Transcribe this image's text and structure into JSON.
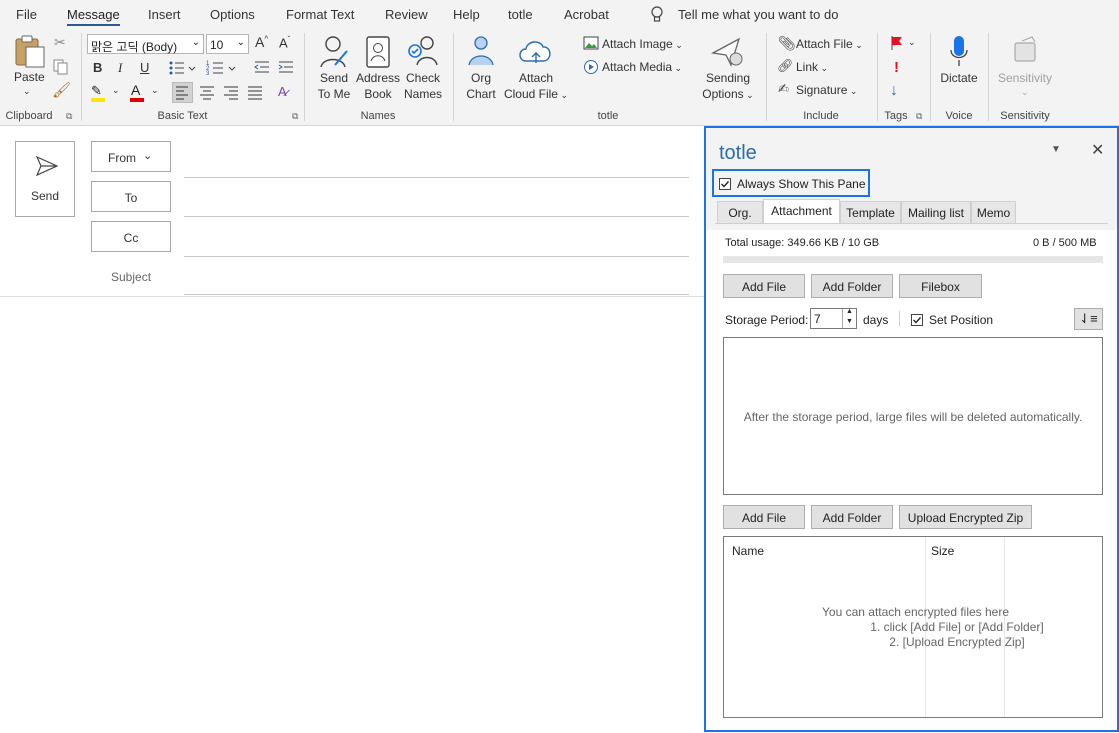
{
  "menu": {
    "file": "File",
    "message": "Message",
    "insert": "Insert",
    "options": "Options",
    "format_text": "Format Text",
    "review": "Review",
    "help": "Help",
    "totle": "totle",
    "acrobat": "Acrobat",
    "tell_me": "Tell me what you want to do"
  },
  "ribbon": {
    "paste": "Paste",
    "clipboard": "Clipboard",
    "font_name": "맑은 고딕 (Body)",
    "font_size": "10",
    "bold": "B",
    "italic": "I",
    "underline": "U",
    "basic_text": "Basic Text",
    "send_to_me": [
      "Send",
      "To Me"
    ],
    "address_book": [
      "Address",
      "Book"
    ],
    "check_names": [
      "Check",
      "Names"
    ],
    "names": "Names",
    "org_chart": [
      "Org",
      "Chart"
    ],
    "attach_cloud": [
      "Attach",
      "Cloud File"
    ],
    "attach_image": "Attach Image",
    "attach_media": "Attach Media",
    "totle_group": "totle",
    "sending_options": [
      "Sending",
      "Options"
    ],
    "attach_file": "Attach File",
    "link": "Link",
    "signature": "Signature",
    "include": "Include",
    "tags": "Tags",
    "dictate": "Dictate",
    "voice": "Voice",
    "sensitivity_btn": "Sensitivity",
    "sensitivity_grp": "Sensitivity"
  },
  "compose": {
    "send": "Send",
    "from": "From",
    "to": "To",
    "cc": "Cc",
    "subject": "Subject"
  },
  "pane": {
    "title": "totle",
    "always_show": "Always Show This Pane",
    "tabs": [
      "Org.",
      "Attachment",
      "Template",
      "Mailing list",
      "Memo"
    ],
    "total_usage": "Total usage: 349.66 KB / 10 GB",
    "quota": "0 B / 500 MB",
    "add_file": "Add File",
    "add_folder": "Add Folder",
    "filebox": "Filebox",
    "storage_period_label": "Storage Period:",
    "storage_period_value": "7",
    "days": "days",
    "set_position": "Set Position",
    "storage_notice": "After the storage period, large files will be deleted automatically.",
    "add_file_2": "Add File",
    "add_folder_2": "Add Folder",
    "upload_zip": "Upload Encrypted Zip",
    "col_name": "Name",
    "col_size": "Size",
    "enc_hint": [
      "You can attach encrypted files here",
      "1. click [Add File] or [Add Folder]",
      "2. [Upload Encrypted Zip]"
    ]
  },
  "colors": {
    "accent_blue": "#1a73e8",
    "title_blue": "#2b6cb0",
    "highlight_yellow": "#ffe500",
    "font_red": "#e00000",
    "flag_red": "#e81123"
  }
}
